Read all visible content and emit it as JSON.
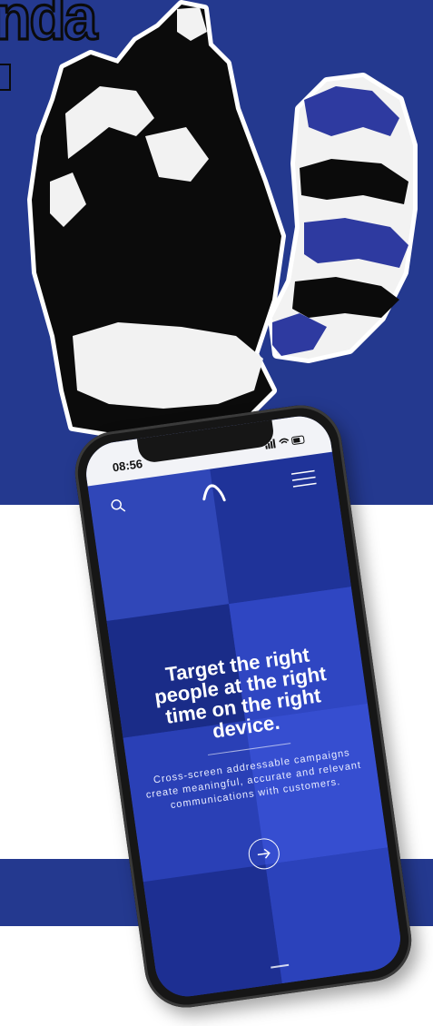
{
  "logo": {
    "text": "nda"
  },
  "phone": {
    "status_time": "08:56",
    "headline": "Target the right people at the right time on the right device.",
    "subtext": "Cross-screen addressable campaigns create meaningful, accurate and relevant communications with customers.",
    "icons": {
      "search": "search-icon",
      "menu": "hamburger-menu-icon",
      "brand": "brand-logo-icon",
      "cta": "arrow-right-icon"
    }
  },
  "colors": {
    "brand_blue": "#24398f",
    "screen_blue": "#2a3fb0",
    "ink": "#0b0b0b",
    "white": "#ffffff"
  }
}
